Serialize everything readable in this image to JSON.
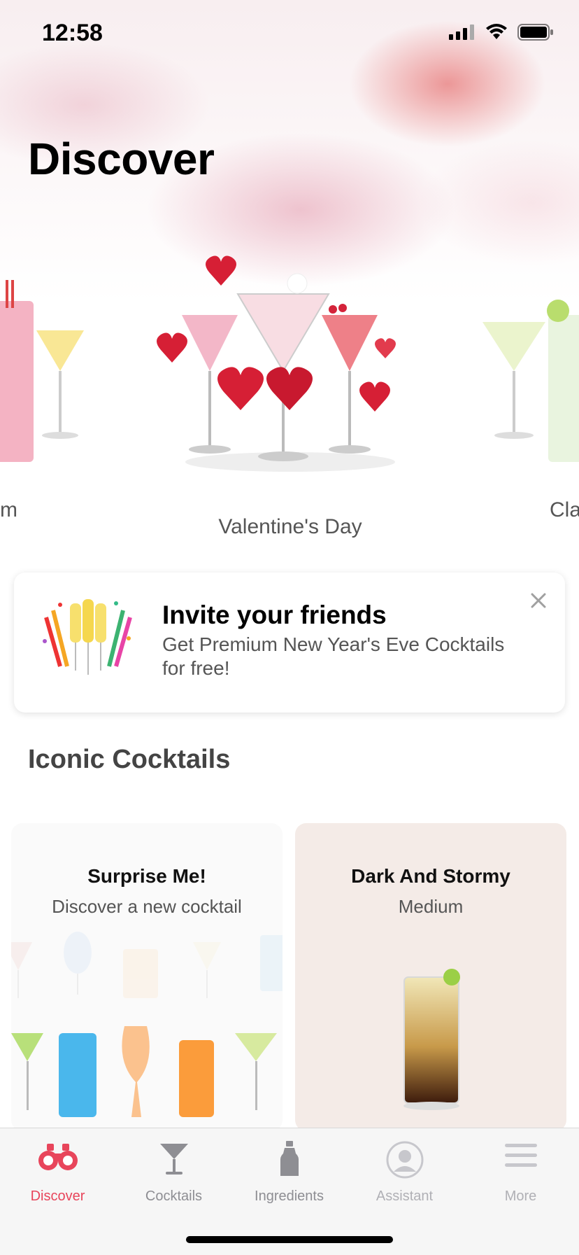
{
  "status_bar": {
    "time": "12:58"
  },
  "header": {
    "title": "Discover"
  },
  "carousel": {
    "slides": [
      {
        "label": "m"
      },
      {
        "label": "Valentine's Day"
      },
      {
        "label": "Cla"
      }
    ]
  },
  "invite": {
    "title": "Invite your friends",
    "subtitle": "Get Premium New Year's Eve Cocktails for free!"
  },
  "iconic": {
    "title": "Iconic Cocktails",
    "cards": [
      {
        "title": "Surprise Me!",
        "subtitle": "Discover a new cocktail"
      },
      {
        "title": "Dark And Stormy",
        "subtitle": "Medium"
      }
    ]
  },
  "tabs": [
    {
      "label": "Discover",
      "icon": "binoculars-icon",
      "active": true
    },
    {
      "label": "Cocktails",
      "icon": "martini-glass-icon",
      "active": false
    },
    {
      "label": "Ingredients",
      "icon": "bottle-icon",
      "active": false
    },
    {
      "label": "Assistant",
      "icon": "bartender-icon",
      "active": false
    },
    {
      "label": "More",
      "icon": "menu-icon",
      "active": false
    }
  ],
  "colors": {
    "accent": "#e8455b",
    "inactive": "#8e8e93"
  }
}
